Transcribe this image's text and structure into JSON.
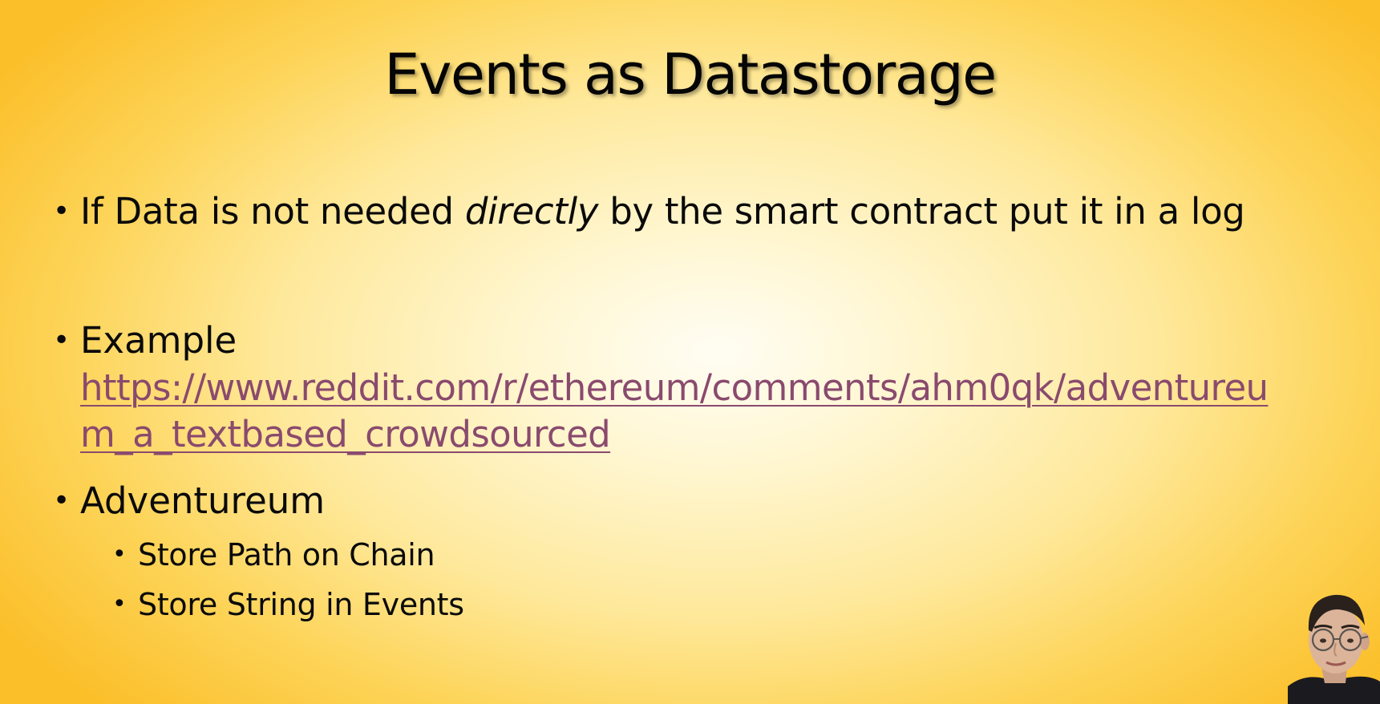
{
  "slide": {
    "title": "Events as Datastorage",
    "bullets": {
      "b1_pre": "If Data is not needed ",
      "b1_em": "directly",
      "b1_post": " by the smart contract put it in a log",
      "b2": "Example",
      "link_line1": "https://www.reddit.com/r/ethereum/comments/ahm0qk/adventureu",
      "link_line2": "m_a_textbased_crowdsourced",
      "b3": "Adventureum",
      "sub1": "Store Path on Chain",
      "sub2": "Store String in Events"
    },
    "bullet_glyph": "•"
  },
  "colors": {
    "link": "#8a4a6e",
    "background_center": "#fffdf4",
    "background_edge": "#fbbf2a"
  },
  "presenter": {
    "icon": "presenter-webcam-icon"
  }
}
